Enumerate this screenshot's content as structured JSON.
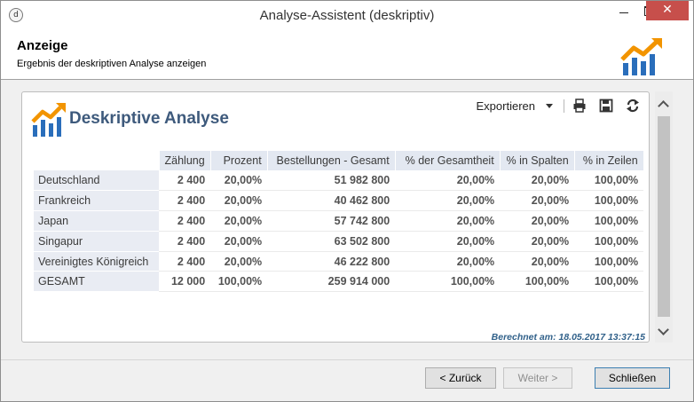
{
  "window": {
    "title": "Analyse-Assistent (deskriptiv)",
    "app_icon_glyph": "d",
    "close_glyph": "✕"
  },
  "header": {
    "title": "Anzeige",
    "subtitle": "Ergebnis der deskriptiven Analyse anzeigen",
    "logo_icon": "analytics-trend-icon"
  },
  "panel": {
    "title": "Deskriptive Analyse",
    "export_label": "Exportieren",
    "toolbar_icons": [
      "print-icon",
      "save-icon",
      "refresh-icon"
    ],
    "computed_text": "Berechnet am: 18.05.2017 13:37:15"
  },
  "table": {
    "columns": [
      "Zählung",
      "Prozent",
      "Bestellungen - Gesamt",
      "% der Gesamtheit",
      "% in Spalten",
      "% in Zeilen"
    ],
    "rows": [
      {
        "label": "Deutschland",
        "values": [
          "2 400",
          "20,00%",
          "51 982 800",
          "20,00%",
          "20,00%",
          "100,00%"
        ]
      },
      {
        "label": "Frankreich",
        "values": [
          "2 400",
          "20,00%",
          "40 462 800",
          "20,00%",
          "20,00%",
          "100,00%"
        ]
      },
      {
        "label": "Japan",
        "values": [
          "2 400",
          "20,00%",
          "57 742 800",
          "20,00%",
          "20,00%",
          "100,00%"
        ]
      },
      {
        "label": "Singapur",
        "values": [
          "2 400",
          "20,00%",
          "63 502 800",
          "20,00%",
          "20,00%",
          "100,00%"
        ]
      },
      {
        "label": "Vereinigtes Königreich",
        "values": [
          "2 400",
          "20,00%",
          "46 222 800",
          "20,00%",
          "20,00%",
          "100,00%"
        ]
      },
      {
        "label": "GESAMT",
        "values": [
          "12 000",
          "100,00%",
          "259 914 000",
          "100,00%",
          "100,00%",
          "100,00%"
        ]
      }
    ]
  },
  "footer": {
    "back_label": "< Zurück",
    "next_label": "Weiter >",
    "close_label": "Schließen"
  },
  "colors": {
    "title_blue": "#3e5a7c",
    "computed_blue": "#31618a",
    "logo_orange": "#f29400",
    "logo_blue": "#2a6ebb",
    "header_cell": "#e3e8f1",
    "close_red": "#c74f4b"
  }
}
